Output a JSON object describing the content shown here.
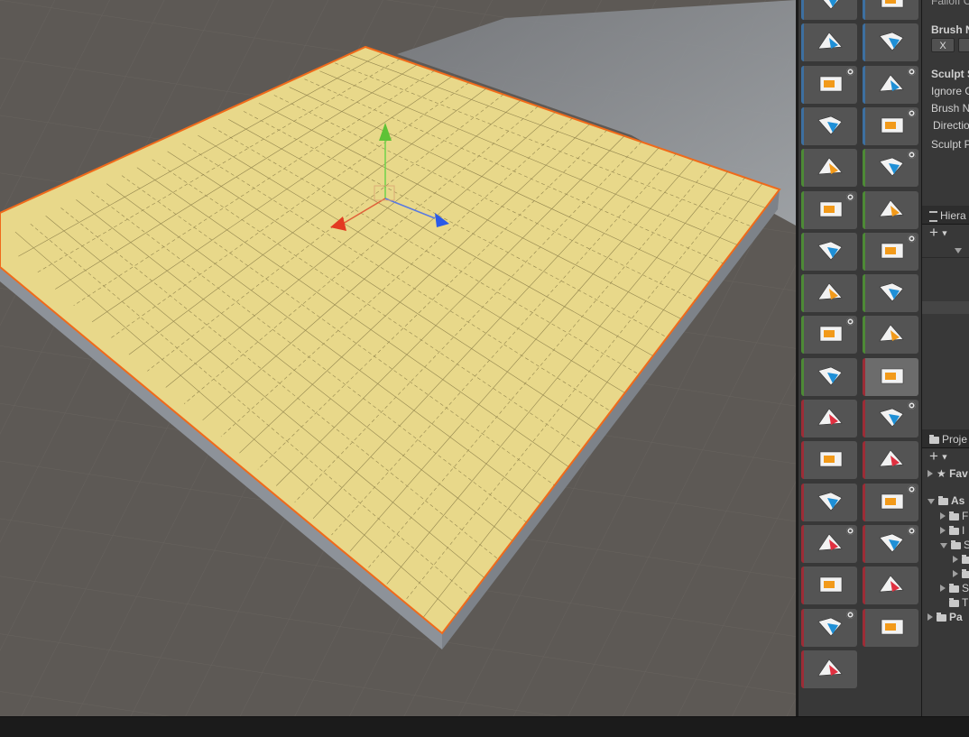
{
  "viewport": {
    "description_icon": "scene-view"
  },
  "toolbar": {
    "buttons": [
      {
        "icon": "world-pivot-icon",
        "group": "blue"
      },
      {
        "icon": "delete-vertex-icon",
        "group": "blue"
      },
      {
        "icon": "select-face-icon",
        "group": "blue"
      },
      {
        "icon": "select-edge-loop-icon",
        "group": "blue"
      },
      {
        "icon": "brick-select-icon",
        "group": "blue",
        "gear": true
      },
      {
        "icon": "cube-select-icon",
        "group": "blue",
        "gear": true
      },
      {
        "icon": "shrink-selection-icon",
        "group": "blue"
      },
      {
        "icon": "grow-selection-icon",
        "group": "blue",
        "gear": true
      },
      {
        "icon": "extrude-forward-icon",
        "group": "green"
      },
      {
        "icon": "extrude-back-icon",
        "group": "green",
        "gear": true
      },
      {
        "icon": "uv2-generate-icon",
        "group": "green",
        "gear": true
      },
      {
        "icon": "flip-face-icon",
        "group": "green"
      },
      {
        "icon": "pivot-center-icon",
        "group": "green"
      },
      {
        "icon": "box-wire-icon",
        "group": "green",
        "gear": true
      },
      {
        "icon": "merge-cube-icon",
        "group": "green"
      },
      {
        "icon": "rotate-face-icon",
        "group": "green"
      },
      {
        "icon": "mirror-object-icon",
        "group": "green",
        "gear": true
      },
      {
        "icon": "split-vertices-icon",
        "group": "green"
      },
      {
        "icon": "freeze-transform-icon",
        "group": "green"
      },
      {
        "icon": "detach-face-icon",
        "group": "red",
        "selected": true
      },
      {
        "icon": "triangulate-face-icon",
        "group": "red"
      },
      {
        "icon": "extrude-face-icon",
        "group": "red",
        "gear": true
      },
      {
        "icon": "flip-normal-icon",
        "group": "red"
      },
      {
        "icon": "insert-edge-icon",
        "group": "red"
      },
      {
        "icon": "conform-normals-icon",
        "group": "red"
      },
      {
        "icon": "cube-blue-icon",
        "group": "red",
        "gear": true
      },
      {
        "icon": "bevel-face-icon",
        "group": "red",
        "gear": true
      },
      {
        "icon": "subdivide-face-icon",
        "group": "red",
        "gear": true
      },
      {
        "icon": "red-face-icon",
        "group": "red"
      },
      {
        "icon": "edge-cut-icon",
        "group": "red"
      },
      {
        "icon": "offset-element-icon",
        "group": "red",
        "gear": true
      },
      {
        "icon": "vertex-colors-icon",
        "group": "red"
      },
      {
        "icon": "set-pivot-icon",
        "group": "red"
      }
    ]
  },
  "inspector": {
    "top_cut": "Falloff C",
    "brush_normal_label": "Brush N",
    "x_button": "X",
    "sculpt_label": "Sculpt S",
    "ignore_label": "Ignore O",
    "brush_n2_label": "Brush N",
    "direction_label": "Directio",
    "sculpt_p_label": "Sculpt P"
  },
  "hierarchy": {
    "tab_label": "Hiera",
    "add_button": "+"
  },
  "project": {
    "tab_label": "Proje",
    "add_button": "+",
    "favorites_label": "Fav",
    "assets_label": "As",
    "packages_label": "Pa",
    "sub_items": [
      "F",
      "I",
      "S",
      "S",
      "T"
    ]
  }
}
